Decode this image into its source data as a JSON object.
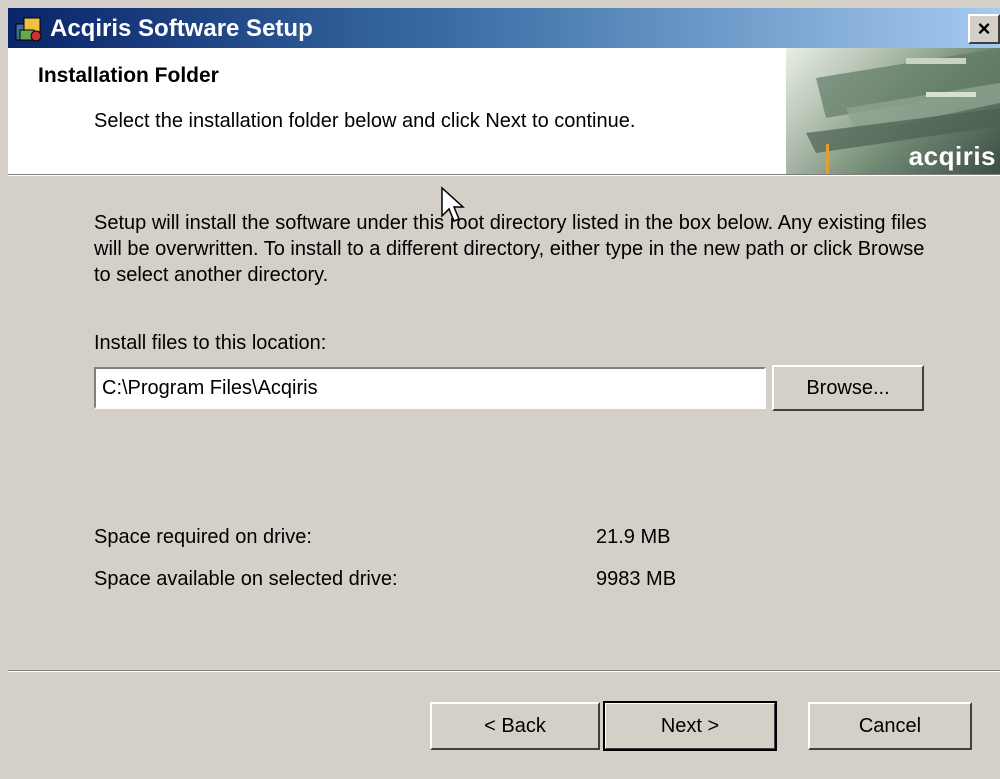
{
  "window": {
    "title": "Acqiris Software Setup",
    "close_label": "×"
  },
  "header": {
    "title": "Installation Folder",
    "subtitle": "Select the installation folder below and click Next to continue.",
    "logo_text": "acqiris"
  },
  "body": {
    "description": "Setup will install the software under this root directory listed in the box below. Any existing files will be overwritten.  To install to a different directory, either type in the new path or click Browse to select another directory.",
    "location_label": "Install files to this location:",
    "location_value": "C:\\Program Files\\Acqiris",
    "browse_label": "Browse..."
  },
  "space": {
    "required_label": "Space required on drive:",
    "required_value": "21.9 MB",
    "available_label": "Space available on selected drive:",
    "available_value": "9983 MB"
  },
  "footer": {
    "back_label": "< Back",
    "next_label": "Next >",
    "cancel_label": "Cancel"
  },
  "colors": {
    "titlebar_start": "#0a246a",
    "titlebar_end": "#a6caf0",
    "dialog_bg": "#d4d0c8"
  },
  "icons": {
    "app": "setup-app-icon",
    "close": "close-icon",
    "cursor": "mouse-pointer-icon"
  }
}
